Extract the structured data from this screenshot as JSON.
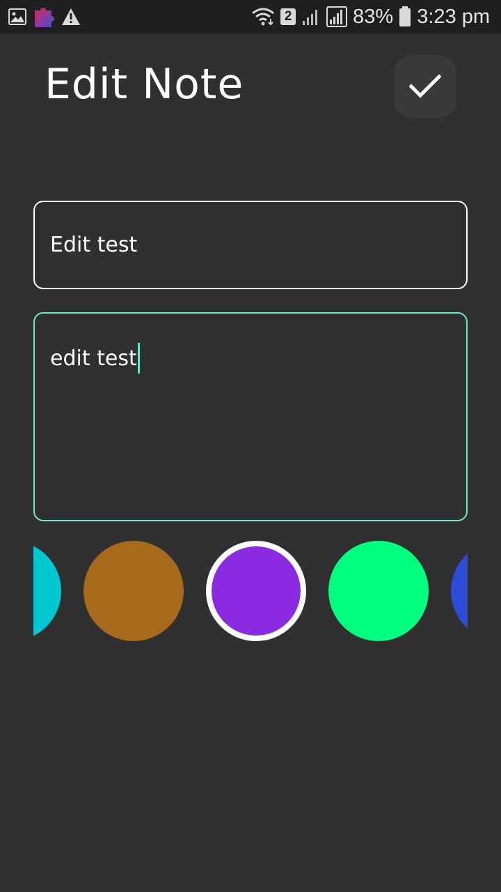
{
  "status_bar": {
    "network_badge": "2",
    "battery": "83%",
    "time": "3:23 pm",
    "icons": [
      "image-icon",
      "puzzle-icon",
      "warning-icon",
      "wifi-icon",
      "signal-icon",
      "signal-icon",
      "battery-icon"
    ]
  },
  "header": {
    "title": "Edit Note",
    "save_icon": "checkmark-icon"
  },
  "form": {
    "title_value": "Edit test",
    "content_value": "edit test"
  },
  "colors": {
    "options": [
      "#00c8d2",
      "#a86a1b",
      "#8a2be2",
      "#00ff7f",
      "#2b4bd8"
    ],
    "selected": "#8a2be2",
    "focus_accent": "#6ee7c8"
  }
}
